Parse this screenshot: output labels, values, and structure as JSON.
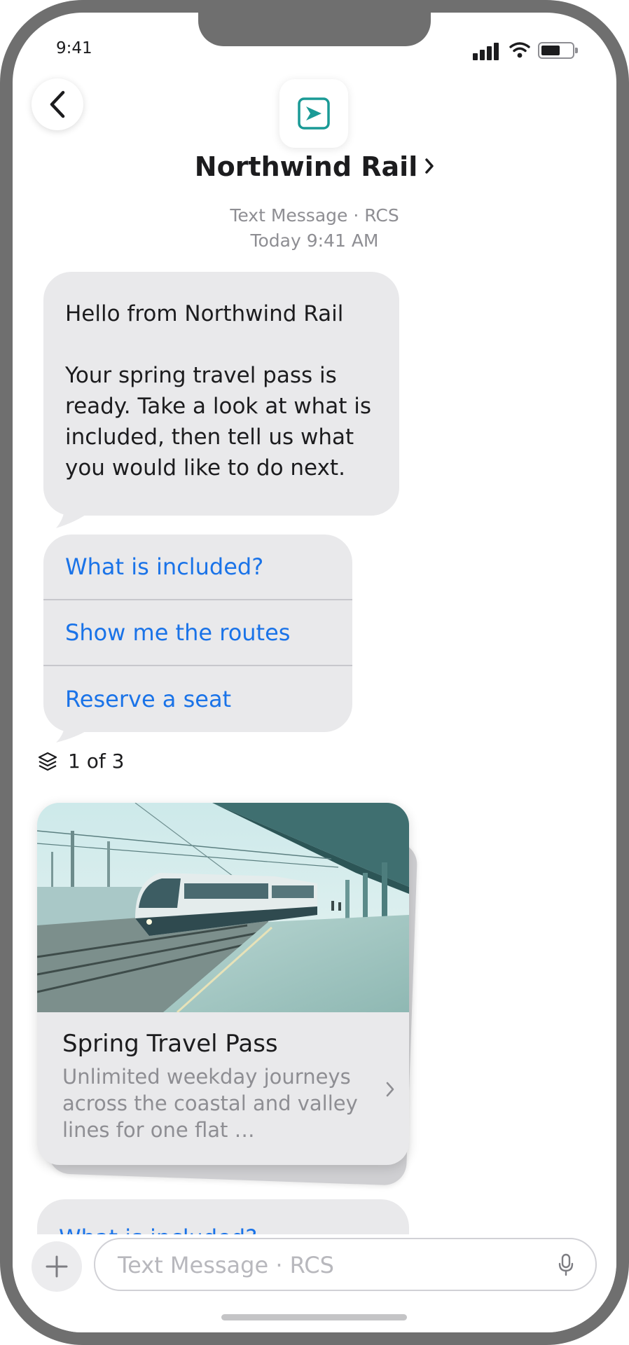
{
  "status_bar": {
    "time": "9:41"
  },
  "header": {
    "contact_name": "Northwind Rail",
    "channel": "Text Message · RCS",
    "timestamp": "Today 9:41 AM"
  },
  "message": {
    "greeting": "Hello from Northwind Rail",
    "body": "Your spring travel pass is ready. Take a look at what is included, then tell us what you would like to do next."
  },
  "suggestions": [
    {
      "label": "What is included?"
    },
    {
      "label": "Show me the routes"
    },
    {
      "label": "Reserve a seat"
    }
  ],
  "carousel": {
    "counter": "1 of 3",
    "card": {
      "title": "Spring Travel Pass",
      "description": "Unlimited weekday journeys across the coastal and valley lines for one flat …"
    }
  },
  "next_bubble_peek": "What is included?",
  "composer": {
    "placeholder": "Text Message · RCS"
  },
  "colors": {
    "brand_teal": "#1a9a96",
    "link_blue": "#1a73e8",
    "bubble_gray": "#e9e9eb"
  },
  "icons": [
    "back-chevron",
    "brand-arrow-logo",
    "layers",
    "chevron-right",
    "plus",
    "microphone",
    "signal",
    "wifi",
    "battery"
  ]
}
